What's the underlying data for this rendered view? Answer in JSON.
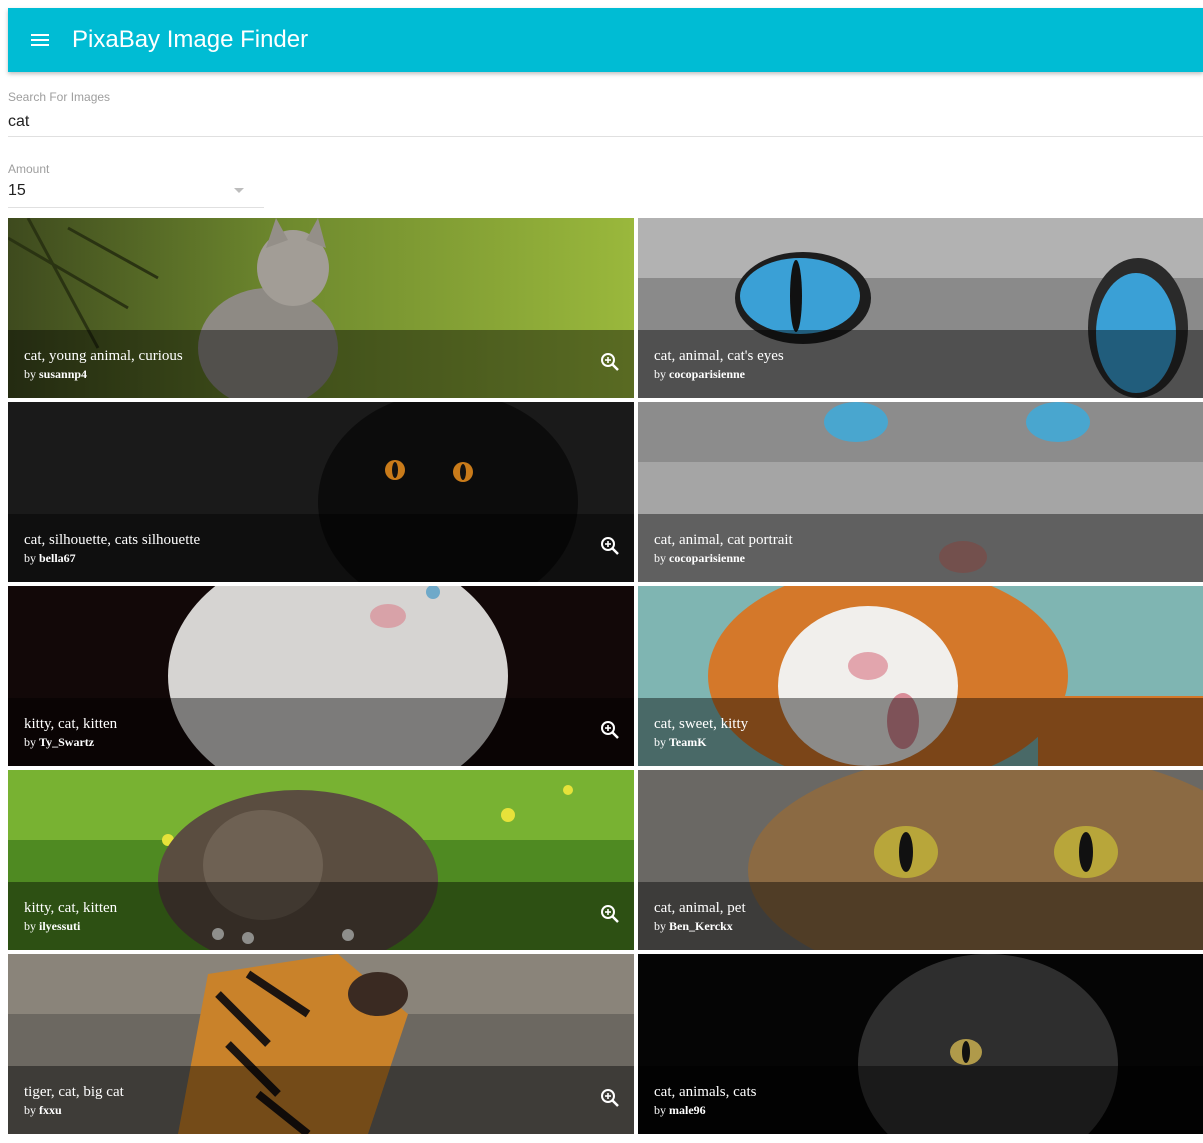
{
  "app": {
    "title": "PixaBay Image Finder"
  },
  "search": {
    "label": "Search For Images",
    "value": "cat"
  },
  "amount": {
    "label": "Amount",
    "value": "15"
  },
  "results": [
    {
      "title": "cat, young animal, curious",
      "by": "by ",
      "user": "susannp4"
    },
    {
      "title": "cat, animal, cat's eyes",
      "by": "by ",
      "user": "cocoparisienne"
    },
    {
      "title": "cat, silhouette, cats silhouette",
      "by": "by ",
      "user": "bella67"
    },
    {
      "title": "cat, animal, cat portrait",
      "by": "by ",
      "user": "cocoparisienne"
    },
    {
      "title": "kitty, cat, kitten",
      "by": "by ",
      "user": "Ty_Swartz"
    },
    {
      "title": "cat, sweet, kitty",
      "by": "by ",
      "user": "TeamK"
    },
    {
      "title": "kitty, cat, kitten",
      "by": "by ",
      "user": "ilyessuti"
    },
    {
      "title": "cat, animal, pet",
      "by": "by ",
      "user": "Ben_Kerckx"
    },
    {
      "title": "tiger, cat, big cat",
      "by": "by ",
      "user": "fxxu"
    },
    {
      "title": "cat, animals, cats",
      "by": "by ",
      "user": "male96"
    }
  ],
  "colors": {
    "appbar": "#00bcd4",
    "text": "#212121",
    "label": "#9e9e9e"
  }
}
